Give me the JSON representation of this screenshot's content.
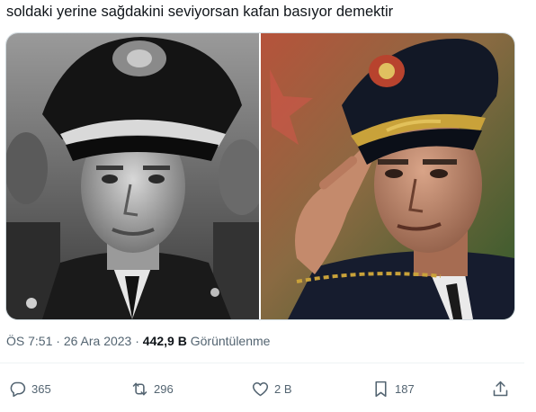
{
  "tweet": {
    "text": "soldaki yerine sağdakini seviyorsan kafan basıyor demektir"
  },
  "media": {
    "left_photo_alt": "Siyah-beyaz, üniformalı ve şapkalı asker portresi",
    "right_photo_alt": "Renkli, selam veren üniformalı komutan fotoğrafı"
  },
  "meta": {
    "time": "ÖS 7:51",
    "separator": "·",
    "date": "26 Ara 2023",
    "views_count": "442,9 B",
    "views_label": "Görüntülenme"
  },
  "actions": {
    "replies": "365",
    "reposts": "296",
    "likes": "2 B",
    "bookmarks": "187"
  },
  "icons": {
    "reply": "reply-icon",
    "repost": "repost-icon",
    "like": "heart-icon",
    "bookmark": "bookmark-icon",
    "share": "share-icon"
  },
  "colors": {
    "text": "#0f1419",
    "muted": "#536471",
    "border": "#cfd9de"
  }
}
